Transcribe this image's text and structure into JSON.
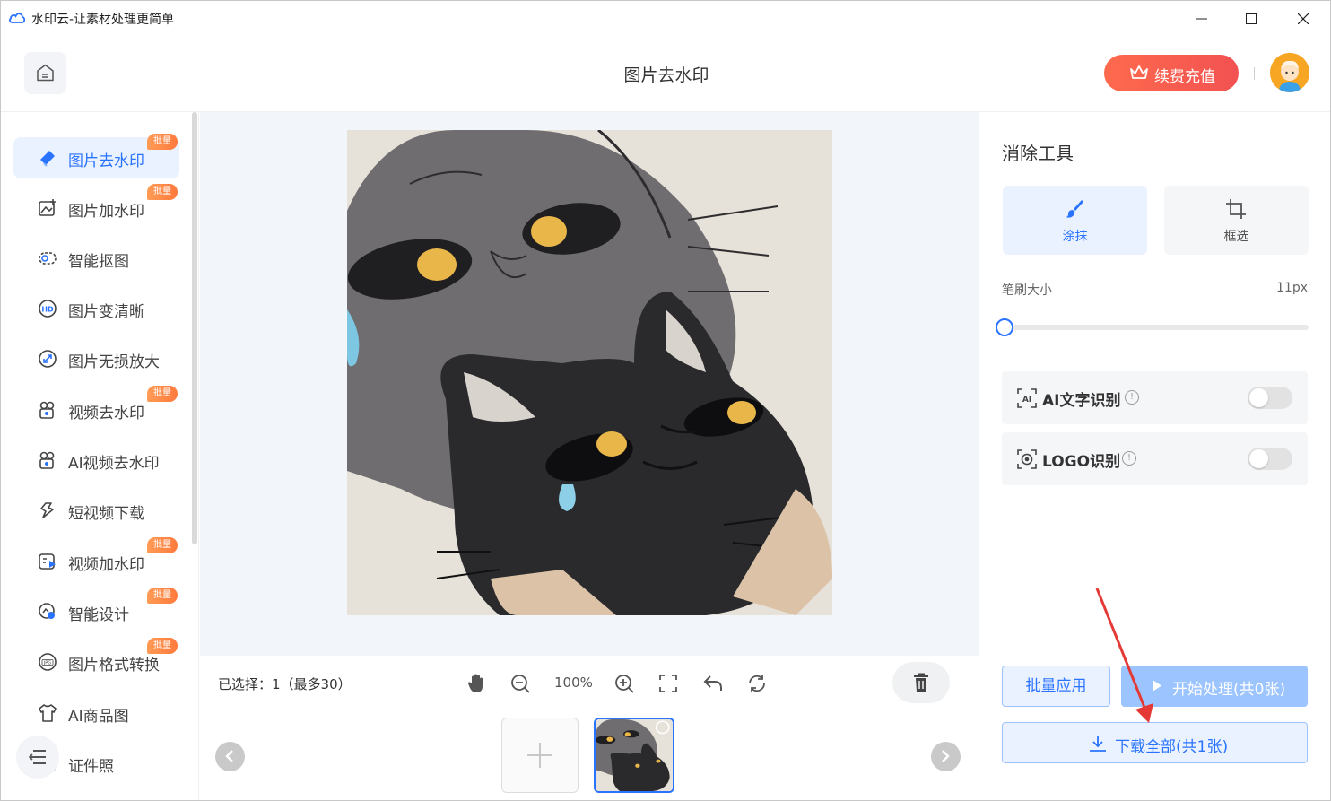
{
  "window": {
    "title": "水印云-让素材处理更简单",
    "controls": [
      "minimize-icon",
      "maximize-icon",
      "close-icon"
    ]
  },
  "header": {
    "home_icon": "home-icon",
    "title": "图片去水印",
    "vip_label": "续费充值",
    "vip_icon": "crown-icon"
  },
  "sidebar": {
    "items": [
      {
        "label": "图片去水印",
        "icon": "eraser-icon",
        "badge": "批量",
        "active": true
      },
      {
        "label": "图片加水印",
        "icon": "image-add-icon",
        "badge": "批量"
      },
      {
        "label": "智能抠图",
        "icon": "cutout-icon",
        "badge": ""
      },
      {
        "label": "图片变清晰",
        "icon": "hd-icon",
        "badge": ""
      },
      {
        "label": "图片无损放大",
        "icon": "enlarge-icon",
        "badge": ""
      },
      {
        "label": "视频去水印",
        "icon": "video-eraser-icon",
        "badge": "批量"
      },
      {
        "label": "AI视频去水印",
        "icon": "ai-video-icon",
        "badge": ""
      },
      {
        "label": "短视频下载",
        "icon": "link-icon",
        "badge": ""
      },
      {
        "label": "视频加水印",
        "icon": "video-add-icon",
        "badge": "批量"
      },
      {
        "label": "智能设计",
        "icon": "design-icon",
        "badge": "批量"
      },
      {
        "label": "图片格式转换",
        "icon": "jpg-icon",
        "badge": "批量"
      },
      {
        "label": "AI商品图",
        "icon": "shirt-icon",
        "badge": ""
      },
      {
        "label": "证件照",
        "icon": "id-photo-icon",
        "badge": ""
      }
    ],
    "menu_icon": "menu-collapse-icon"
  },
  "toolbar": {
    "selection": "已选择：1（最多30）",
    "zoom": "100%",
    "tools": [
      "hand-icon",
      "zoom-out-icon",
      "zoom-in-icon",
      "fit-screen-icon",
      "undo-icon",
      "reset-icon"
    ],
    "delete_icon": "trash-icon"
  },
  "thumbnails": {
    "add_icon": "plus-icon",
    "count": 1
  },
  "panel": {
    "title": "消除工具",
    "modes": [
      {
        "label": "涂抹",
        "icon": "brush-icon",
        "active": true
      },
      {
        "label": "框选",
        "icon": "crop-icon",
        "active": false
      }
    ],
    "brush_size_label": "笔刷大小",
    "brush_size_value": "11px",
    "brush_size_fraction": 0.0,
    "options": [
      {
        "label": "AI文字识别",
        "icon": "ai-text-icon",
        "enabled": false
      },
      {
        "label": "LOGO识别",
        "icon": "logo-detect-icon",
        "enabled": false
      }
    ],
    "batch_apply": "批量应用",
    "start_process": "开始处理(共0张)",
    "download_all": "下载全部(共1张)"
  },
  "colors": {
    "accent": "#2a73ff",
    "vip_gradient_start": "#ff6a4d",
    "vip_gradient_end": "#f25252",
    "badge": "#ff8a45",
    "annotation_arrow": "#e53935"
  }
}
